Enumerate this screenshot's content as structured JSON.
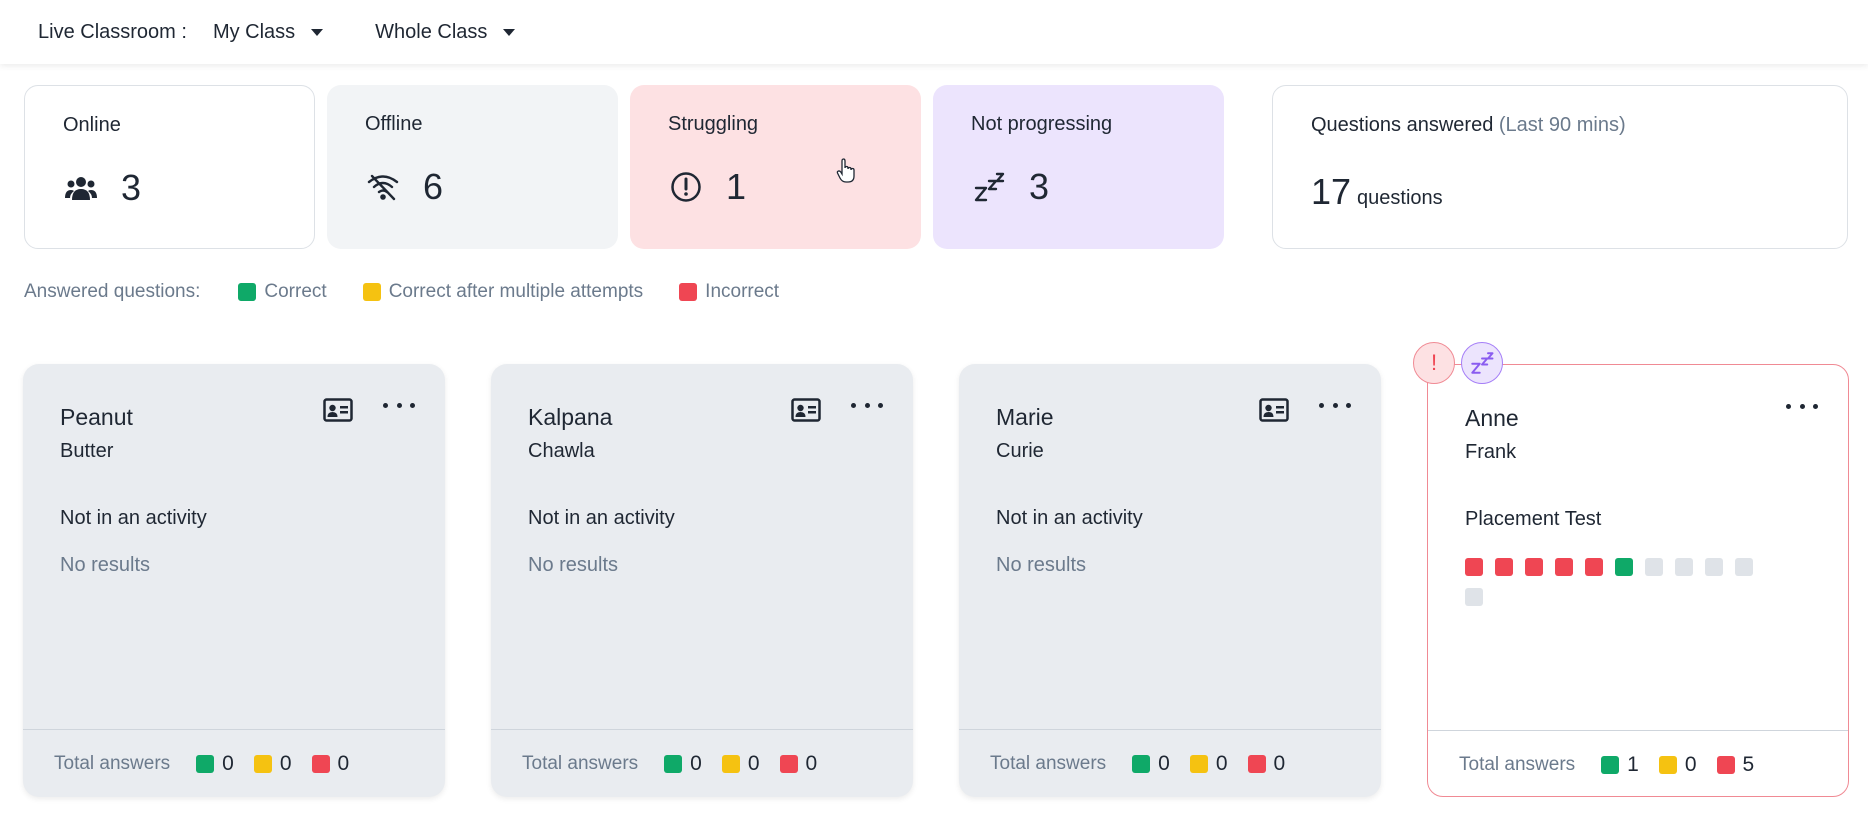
{
  "header": {
    "label": "Live Classroom :",
    "class_select": "My Class",
    "group_select": "Whole Class"
  },
  "stats": {
    "online": {
      "title": "Online",
      "value": "3",
      "icon": "users-icon"
    },
    "offline": {
      "title": "Offline",
      "value": "6",
      "icon": "wifi-off-icon"
    },
    "struggling": {
      "title": "Struggling",
      "value": "1",
      "icon": "alert-circle-icon"
    },
    "not_progressing": {
      "title": "Not progressing",
      "value": "3",
      "icon": "zzz-icon"
    },
    "questions": {
      "title": "Questions answered",
      "subtitle": "(Last 90 mins)",
      "value": "17",
      "unit": "questions"
    }
  },
  "legend": {
    "title": "Answered questions:",
    "correct": "Correct",
    "multi": "Correct after multiple attempts",
    "incorrect": "Incorrect"
  },
  "colors": {
    "correct": "#0fa968",
    "multi": "#f5c211",
    "incorrect": "#ef4653",
    "unanswered": "#dfe3e8"
  },
  "students": [
    {
      "first": "Peanut",
      "last": "Butter",
      "activity": "Not in an activity",
      "results": "No results",
      "footer_label": "Total answers",
      "correct": "0",
      "multi": "0",
      "incorrect": "0"
    },
    {
      "first": "Kalpana",
      "last": "Chawla",
      "activity": "Not in an activity",
      "results": "No results",
      "footer_label": "Total answers",
      "correct": "0",
      "multi": "0",
      "incorrect": "0"
    },
    {
      "first": "Marie",
      "last": "Curie",
      "activity": "Not in an activity",
      "results": "No results",
      "footer_label": "Total answers",
      "correct": "0",
      "multi": "0",
      "incorrect": "0"
    },
    {
      "first": "Anne",
      "last": "Frank",
      "activity": "Placement Test",
      "footer_label": "Total answers",
      "correct": "1",
      "multi": "0",
      "incorrect": "5",
      "progress": [
        "incorrect",
        "incorrect",
        "incorrect",
        "incorrect",
        "incorrect",
        "correct",
        "unanswered",
        "unanswered",
        "unanswered",
        "unanswered",
        "unanswered"
      ],
      "badges": [
        "alert-icon",
        "zzz-icon"
      ]
    }
  ]
}
